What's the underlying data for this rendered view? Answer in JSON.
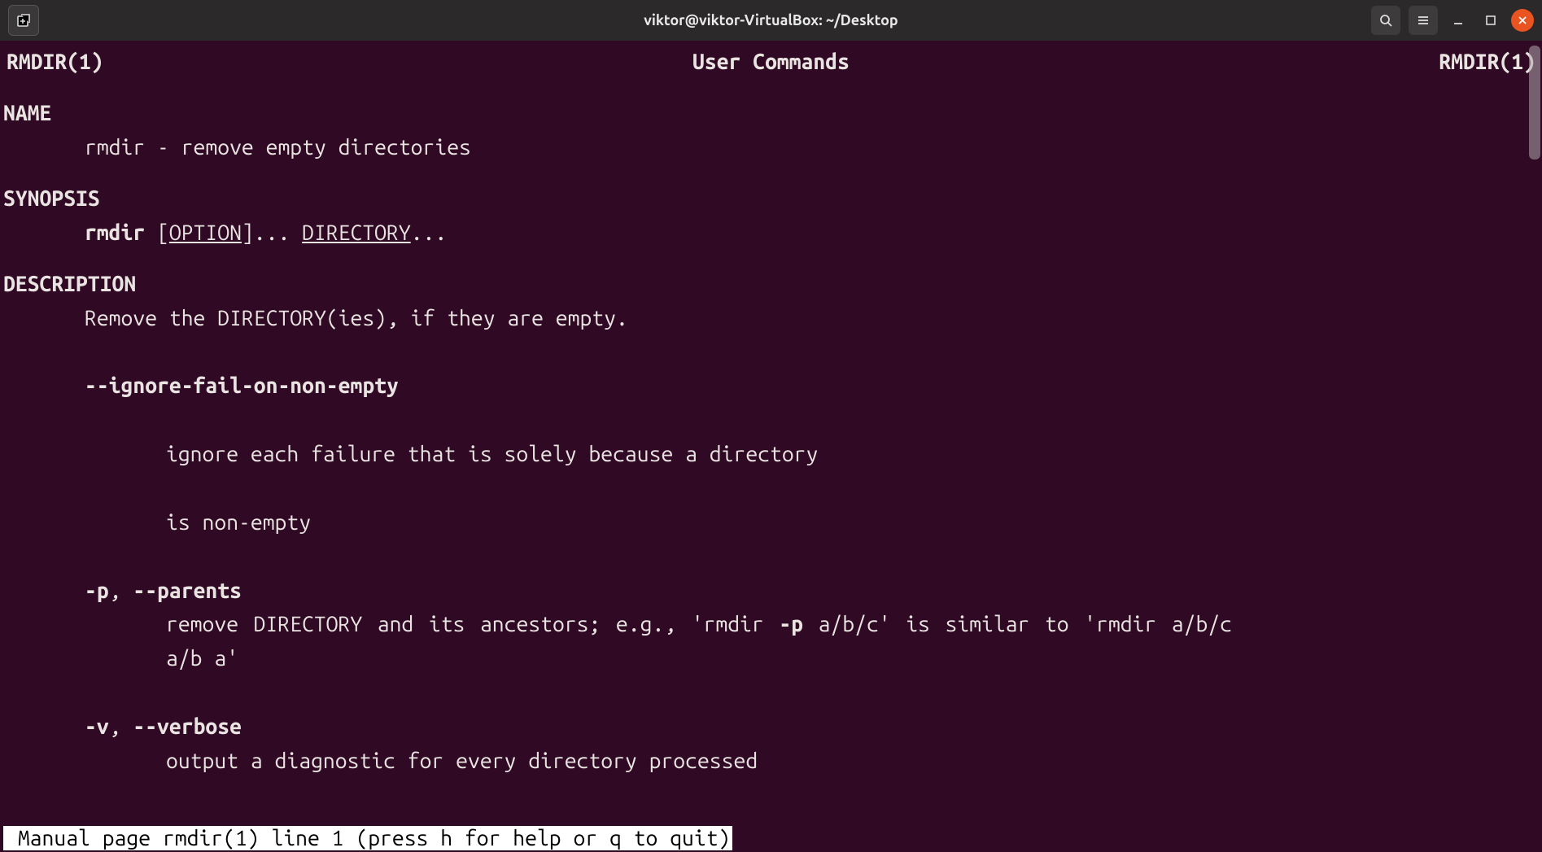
{
  "window": {
    "title": "viktor@viktor-VirtualBox: ~/Desktop"
  },
  "man": {
    "header_left": "RMDIR(1)",
    "header_center": "User Commands",
    "header_right": "RMDIR(1)",
    "sec_name": "NAME",
    "name_line": "rmdir - remove empty directories",
    "sec_synopsis": "SYNOPSIS",
    "syn_cmd": "rmdir",
    "syn_lb": " [",
    "syn_option": "OPTION",
    "syn_rb": "]... ",
    "syn_dir": "DIRECTORY",
    "syn_tail": "...",
    "sec_description": "DESCRIPTION",
    "desc_line": "Remove the DIRECTORY(ies), if they are empty.",
    "opt_ignore": "--ignore-fail-on-non-empty",
    "ignore_l1": "ignore each failure that is solely because a directory",
    "ignore_l2": "is non-empty",
    "opt_p": "-p",
    "comma_sp": ", ",
    "opt_parents": "--parents",
    "parents_body_a": "remove  DIRECTORY  and  its  ancestors; e.g., 'rmdir ",
    "parents_body_bold": "-p",
    "parents_body_b": " a/b/c' is similar to 'rmdir a/b/c a/b a'",
    "opt_v": "-v",
    "opt_verbose": "--verbose",
    "verbose_body": "output a diagnostic for every directory processed",
    "status": " Manual page rmdir(1) line 1 (press h for help or q to quit)"
  }
}
